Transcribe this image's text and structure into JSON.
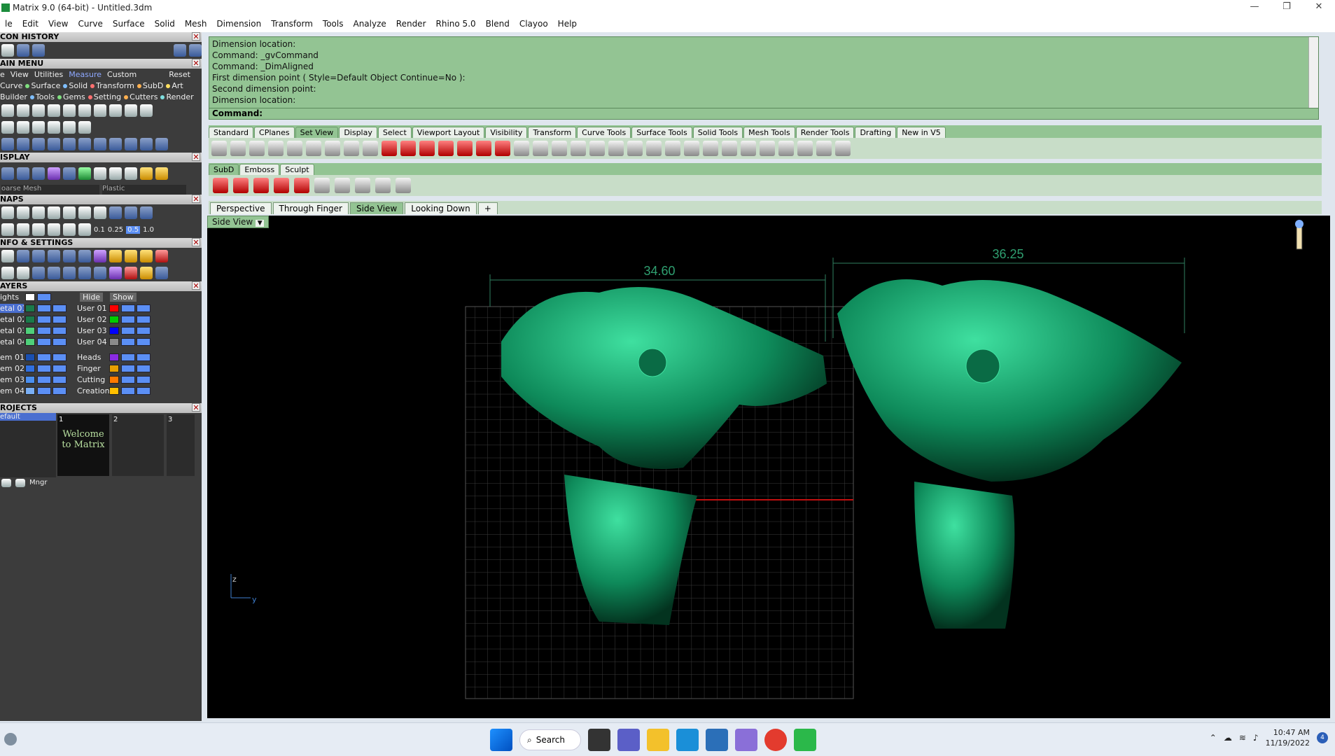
{
  "window": {
    "title": "Matrix 9.0 (64-bit) - Untitled.3dm",
    "minimize": "—",
    "maximize": "❐",
    "close": "✕"
  },
  "menu": [
    "le",
    "Edit",
    "View",
    "Curve",
    "Surface",
    "Solid",
    "Mesh",
    "Dimension",
    "Transform",
    "Tools",
    "Analyze",
    "Render",
    "Rhino 5.0",
    "Blend",
    "Clayoo",
    "Help"
  ],
  "left": {
    "icon_history": "CON HISTORY",
    "main_menu": "AIN MENU",
    "main_tabs": [
      "e",
      "View",
      "Utilities",
      "Measure",
      "Custom",
      "Reset"
    ],
    "main_row1": [
      "Curve",
      "Surface",
      "Solid",
      "Transform",
      "SubD",
      "Art"
    ],
    "main_row2": [
      "Builder",
      "Tools",
      "Gems",
      "Setting",
      "Cutters",
      "Render"
    ],
    "display": "ISPLAY",
    "display_mesh": "oarse Mesh",
    "display_mat": "Plastic",
    "snaps": "NAPS",
    "snap_vals": [
      "0.1",
      "0.25",
      "0.5",
      "1.0"
    ],
    "info": "NFO & SETTINGS",
    "layers": "AYERS",
    "lights": "ights",
    "hide": "Hide",
    "show": "Show",
    "layer_left": [
      "etal 01",
      "etal 02",
      "etal 03",
      "etal 04",
      "em 01",
      "em 02",
      "em 03",
      "em 04"
    ],
    "layer_right": [
      "User 01",
      "User 02",
      "User 03",
      "User 04",
      "Heads",
      "Finger",
      "Cutting",
      "Creation"
    ],
    "layer_colors": [
      "#ff0000",
      "#00cc00",
      "#0000ff",
      "#8a8a8a",
      "#8a2be2",
      "#e8a000",
      "#ff7a00",
      "#ffc000"
    ],
    "projects": "ROJECTS",
    "project_default": "efault",
    "project_slots": [
      "1",
      "2",
      "3"
    ],
    "welcome": "Welcome to Matrix",
    "mngr": "Mngr"
  },
  "command": {
    "history": [
      "Dimension location:",
      "Command: _gvCommand",
      "Command: _DimAligned",
      "First dimension point ( Style=Default  Object  Continue=No ):",
      "Second dimension point:",
      "Dimension location:"
    ],
    "prompt": "Command:"
  },
  "toolbar_tabs": [
    "Standard",
    "CPlanes",
    "Set View",
    "Display",
    "Select",
    "Viewport Layout",
    "Visibility",
    "Transform",
    "Curve Tools",
    "Surface Tools",
    "Solid Tools",
    "Mesh Tools",
    "Render Tools",
    "Drafting",
    "New in V5"
  ],
  "toolbar_tabs_active": "Set View",
  "subd_tabs": [
    "SubD",
    "Emboss",
    "Sculpt"
  ],
  "view_tabs": [
    "Perspective",
    "Through Finger",
    "Side View",
    "Looking Down"
  ],
  "view_tab_add": "+",
  "viewport": {
    "label": "Side View",
    "dim1": "34.60",
    "dim2": "36.25",
    "axis_z": "z",
    "axis_y": "y"
  },
  "taskbar": {
    "search": "Search",
    "time": "10:47 AM",
    "date": "11/19/2022",
    "badge": "4"
  },
  "colors": {
    "accent_green": "#93c493",
    "model_green": "#0e8a5a",
    "viewport_bg": "#000000"
  }
}
